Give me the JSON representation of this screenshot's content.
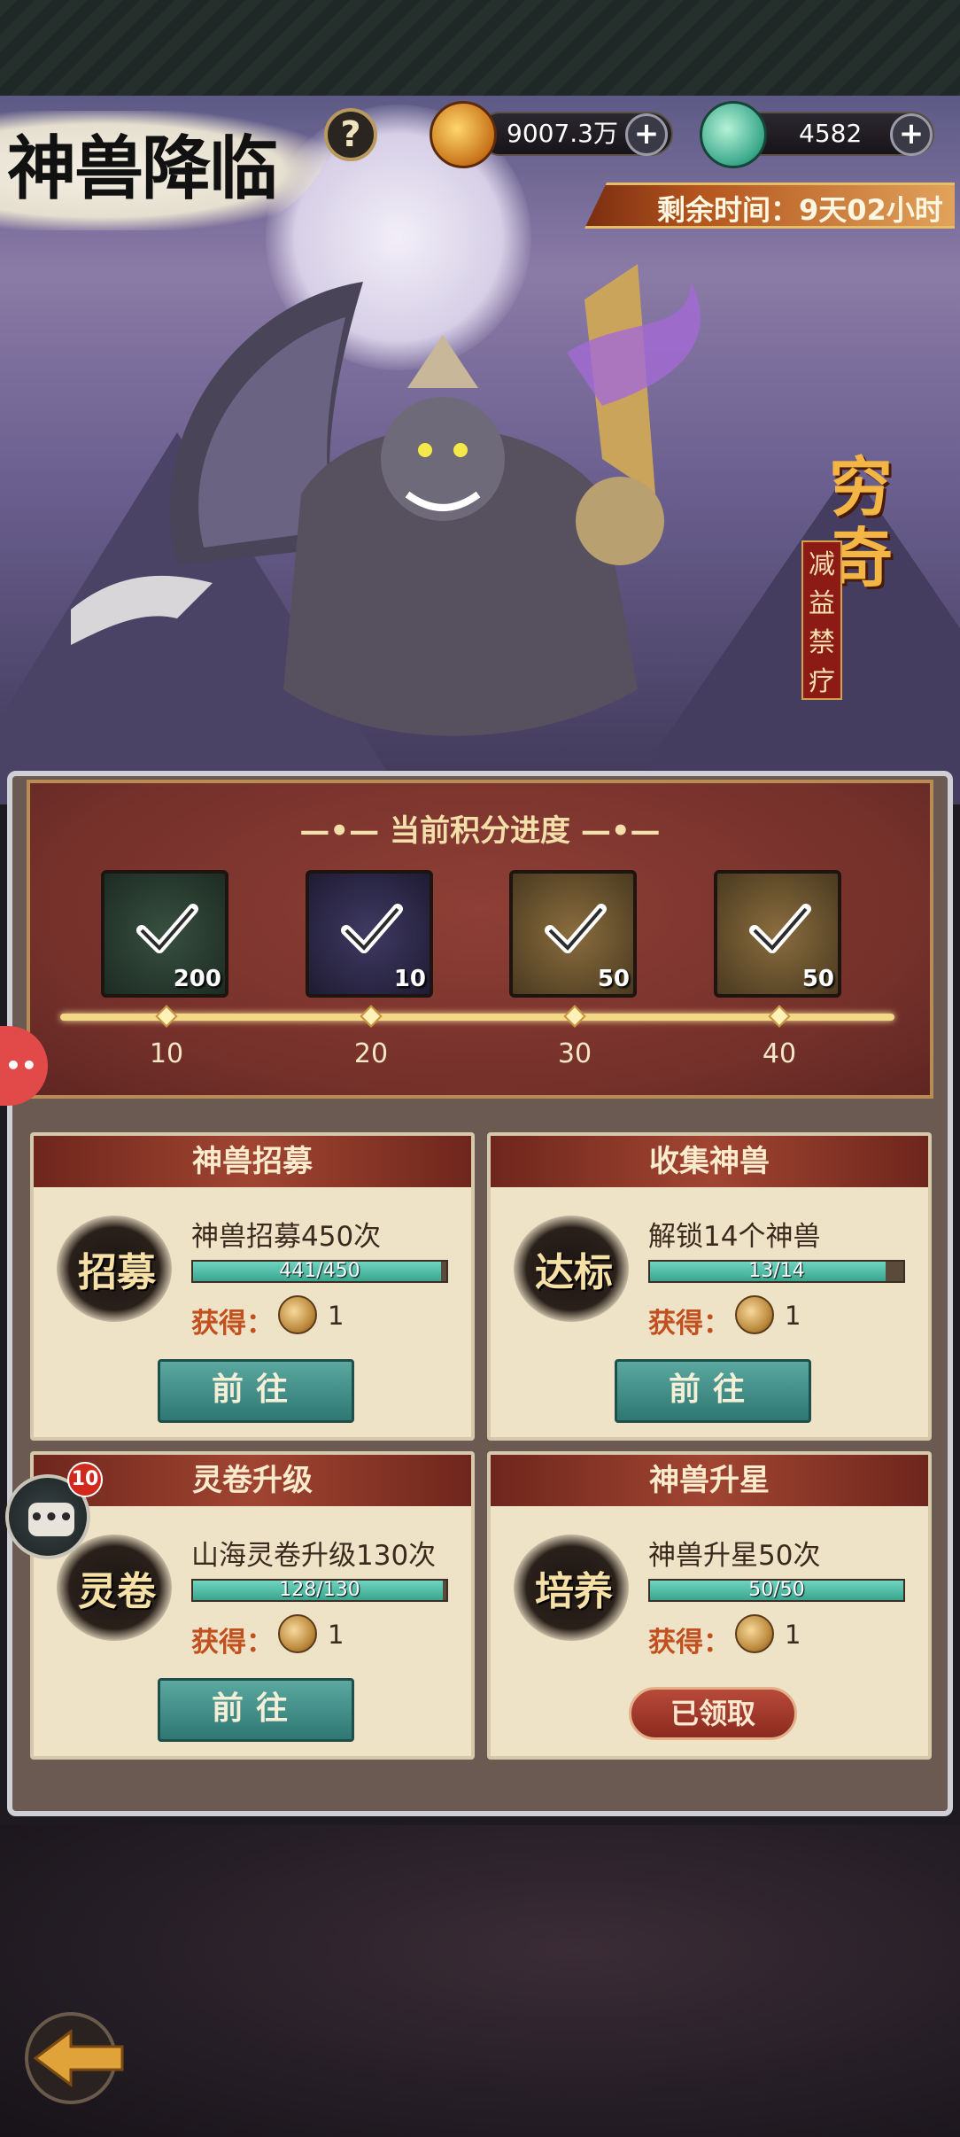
{
  "header": {
    "title": "神兽降临",
    "help_label": "?",
    "currency_gold": "9007.3万",
    "currency_jade": "4582",
    "plus_label": "+",
    "timer": "剩余时间：9天02小时"
  },
  "hero": {
    "beast_name": "穷奇",
    "beast_skill": "减益禁疗"
  },
  "progress": {
    "title": "—•— 当前积分进度 —•—",
    "rewards": [
      {
        "count": "200",
        "claimed": true
      },
      {
        "count": "10",
        "claimed": true
      },
      {
        "count": "50",
        "claimed": true
      },
      {
        "count": "50",
        "claimed": true
      }
    ],
    "milestones": [
      "10",
      "20",
      "30",
      "40"
    ]
  },
  "tasks": [
    {
      "header": "神兽招募",
      "emblem": "招募",
      "task": "神兽招募450次",
      "progress_text": "441/450",
      "progress": 0.98,
      "reward_label": "获得：",
      "reward_qty": "1",
      "button": "前往",
      "claimed": false
    },
    {
      "header": "收集神兽",
      "emblem": "达标",
      "task": "解锁14个神兽",
      "progress_text": "13/14",
      "progress": 0.93,
      "reward_label": "获得：",
      "reward_qty": "1",
      "button": "前往",
      "claimed": false
    },
    {
      "header": "灵卷升级",
      "emblem": "灵卷",
      "task": "山海灵卷升级130次",
      "progress_text": "128/130",
      "progress": 0.985,
      "reward_label": "获得：",
      "reward_qty": "1",
      "button": "前往",
      "claimed": false
    },
    {
      "header": "神兽升星",
      "emblem": "培养",
      "task": "神兽升星50次",
      "progress_text": "50/50",
      "progress": 1.0,
      "reward_label": "获得：",
      "reward_qty": "1",
      "button": "已领取",
      "claimed": true
    }
  ],
  "chat": {
    "badge": "10",
    "dots": "•••"
  },
  "side_handle": "••",
  "colors": {
    "accent": "#3aa58f",
    "claimed": "#8a2a20",
    "header": "#a14532"
  }
}
